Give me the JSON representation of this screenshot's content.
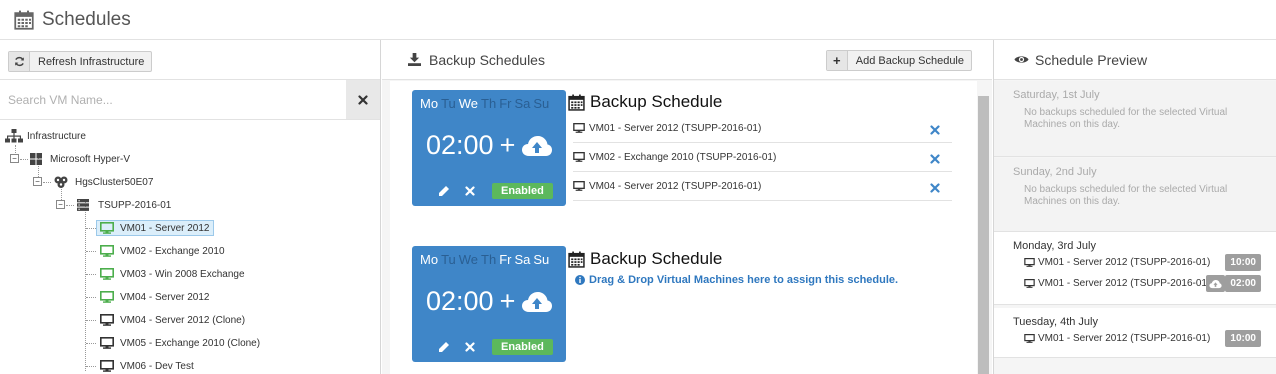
{
  "page": {
    "title": "Schedules"
  },
  "left": {
    "refresh_label": "Refresh Infrastructure",
    "search_placeholder": "Search VM Name...",
    "tree": {
      "root": "Infrastructure",
      "hyperv": "Microsoft Hyper-V",
      "cluster": "HgsCluster50E07",
      "host": "TSUPP-2016-01",
      "vms": [
        {
          "label": "VM01 - Server 2012",
          "state": "running",
          "selected": true
        },
        {
          "label": "VM02 - Exchange 2010",
          "state": "running",
          "selected": false
        },
        {
          "label": "VM03 - Win 2008 Exchange",
          "state": "running",
          "selected": false
        },
        {
          "label": "VM04 - Server 2012",
          "state": "running",
          "selected": false
        },
        {
          "label": "VM04 - Server 2012 (Clone)",
          "state": "off",
          "selected": false
        },
        {
          "label": "VM05 - Exchange 2010 (Clone)",
          "state": "off",
          "selected": false
        },
        {
          "label": "VM06 - Dev Test",
          "state": "off",
          "selected": false
        }
      ]
    }
  },
  "middle": {
    "title": "Backup Schedules",
    "add_label": "Add Backup Schedule",
    "schedules": [
      {
        "title": "Backup Schedule",
        "days": [
          {
            "d": "Mo",
            "on": true
          },
          {
            "d": "Tu",
            "on": false
          },
          {
            "d": "We",
            "on": true
          },
          {
            "d": "Th",
            "on": false
          },
          {
            "d": "Fr",
            "on": false
          },
          {
            "d": "Sa",
            "on": false
          },
          {
            "d": "Su",
            "on": false
          }
        ],
        "time": "02:00",
        "plus": "+",
        "status": "Enabled",
        "vms": [
          "VM01 - Server 2012 (TSUPP-2016-01)",
          "VM02 - Exchange 2010 (TSUPP-2016-01)",
          "VM04 - Server 2012 (TSUPP-2016-01)"
        ]
      },
      {
        "title": "Backup Schedule",
        "days": [
          {
            "d": "Mo",
            "on": true
          },
          {
            "d": "Tu",
            "on": false
          },
          {
            "d": "We",
            "on": false
          },
          {
            "d": "Th",
            "on": false
          },
          {
            "d": "Fr",
            "on": true
          },
          {
            "d": "Sa",
            "on": true
          },
          {
            "d": "Su",
            "on": true
          }
        ],
        "time": "02:00",
        "plus": "+",
        "status": "Enabled",
        "hint": "Drag & Drop Virtual Machines here to assign this schedule."
      }
    ]
  },
  "right": {
    "title": "Schedule Preview",
    "days": [
      {
        "name": "Saturday, 1st July",
        "note": "No backups scheduled for the selected Virtual Machines on this day."
      },
      {
        "name": "Sunday, 2nd July",
        "note": "No backups scheduled for the selected Virtual Machines on this day."
      },
      {
        "name": "Monday, 3rd July",
        "entries": [
          {
            "vm": "VM01 - Server 2012 (TSUPP-2016-01)",
            "time": "10:00"
          },
          {
            "vm": "VM01 - Server 2012 (TSUPP-2016-01)",
            "time": "02:00"
          }
        ]
      },
      {
        "name": "Tuesday, 4th July",
        "entries": [
          {
            "vm": "VM01 - Server 2012 (TSUPP-2016-01)",
            "time": "10:00"
          }
        ]
      }
    ]
  },
  "colors": {
    "accent": "#3f86c8",
    "enabled": "#5cb85c",
    "running": "#4cae4c",
    "remove": "#3f86c8"
  }
}
